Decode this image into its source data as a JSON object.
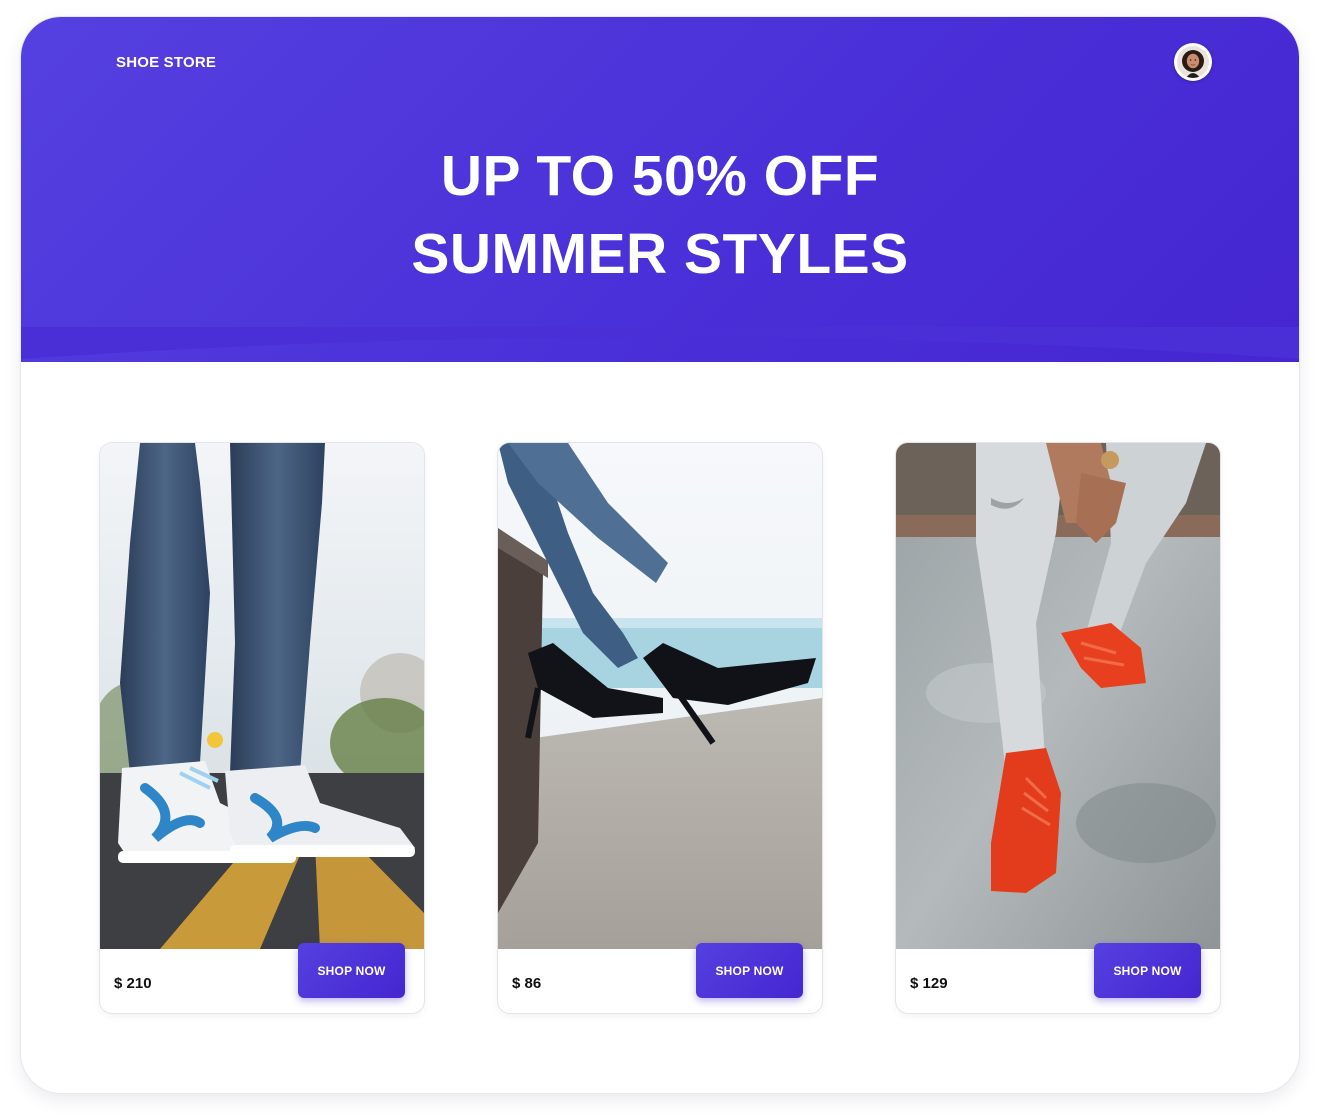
{
  "header": {
    "brand": "SHOE STORE",
    "avatar_icon": "user-avatar"
  },
  "hero": {
    "line1": "UP TO 50% OFF",
    "line2": "SUMMER STYLES"
  },
  "colors": {
    "accent": "#4B30D9",
    "accent_dark": "#4526D0"
  },
  "products": [
    {
      "image": "white-blue-sneakers-photo",
      "price": "$ 210",
      "button": "SHOP NOW"
    },
    {
      "image": "black-high-heels-photo",
      "price": "$ 86",
      "button": "SHOP NOW"
    },
    {
      "image": "red-sneakers-photo",
      "price": "$ 129",
      "button": "SHOP NOW"
    }
  ]
}
